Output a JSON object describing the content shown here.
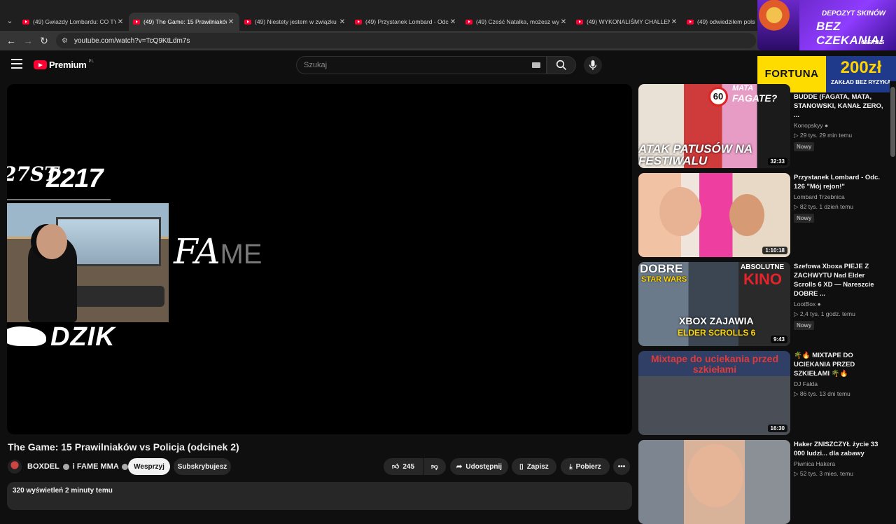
{
  "tabs": [
    {
      "title": "(49) Gwiazdy Lombardu: CO TY",
      "active": false
    },
    {
      "title": "(49) The Game: 15 Prawilniaków",
      "active": true
    },
    {
      "title": "(49) Niestety jestem w związku",
      "active": false
    },
    {
      "title": "(49) Przystanek Lombard - Odc",
      "active": false
    },
    {
      "title": "(49) Cześć Natalka, możesz wyj",
      "active": false
    },
    {
      "title": "(49) WYKONALIŚMY CHALLENG",
      "active": false
    },
    {
      "title": "(49) odwiedziłem polskie",
      "active": false
    }
  ],
  "address": {
    "url": "youtube.com/watch?v=TcQ9KtLdm7s"
  },
  "ads": {
    "skins": {
      "line1": "DEPOZYT SKINÓW",
      "line2": "BEZ CZEKANIA!",
      "brand": "64SKINS"
    },
    "fortuna": {
      "brand": "FORTUNA",
      "amount": "200zł",
      "note": "ZAKŁAD BEZ RYZYKA"
    }
  },
  "header": {
    "brand": "Premium",
    "region": "PL",
    "search_placeholder": "Szukaj"
  },
  "overlay": {
    "tag_sig": "27ST",
    "tag_number": "2217",
    "dzik": "DZIK",
    "fame_italic": "FA",
    "fame_rest": "ME"
  },
  "video": {
    "title": "The Game: 15 Prawilniaków vs Policja (odcinek 2)",
    "channel": "BOXDEL",
    "channel_sep": "i",
    "channel2": "FAME MMA",
    "support": "Wesprzyj",
    "subscribed": "Subskrybujesz",
    "likes": "245",
    "share": "Udostępnij",
    "save": "Zapisz",
    "download": "Pobierz",
    "stats": "320 wyświetleń  2 minuty temu"
  },
  "recommendations": [
    {
      "title": "BUDDE (FAGATA, MATA, STANOWSKI, KANAŁ ZERO, ...",
      "channel": "Konopskyy",
      "verified": true,
      "views": "29 tys.",
      "age": "29 min temu",
      "badge": "Nowy",
      "duration": "32:33",
      "thumb_text": "ATAK PATUSÓW NA FESTIWALU",
      "thumb_top": "MATA",
      "thumb_top2": "FAGATE?",
      "thumb_sign": "60"
    },
    {
      "title": "Przystanek Lombard - Odc. 126 \"Mój rejon!\"",
      "channel": "Lombard Trzebnica",
      "verified": false,
      "views": "82 tys.",
      "age": "1 dzień temu",
      "badge": "Nowy",
      "duration": "1:10:18"
    },
    {
      "title": "Szefowa Xboxa PIEJE Z ZACHWYTU Nad Elder Scrolls 6 XD — Nareszcie DOBRE ...",
      "channel": "LootBox",
      "verified": true,
      "views": "2,4 tys.",
      "age": "1 godz. temu",
      "badge": "Nowy",
      "duration": "9:43",
      "thumb_l1": "DOBRE",
      "thumb_l2": "STAR WARS",
      "thumb_r1": "ABSOLUTNE",
      "thumb_r2": "KINO",
      "thumb_b1": "XBOX ZAJAWIA",
      "thumb_b2": "ELDER SCROLLS 6"
    },
    {
      "title": "🌴🔥 MIXTAPE DO UCIEKANIA PRZED SZKIEŁAMI 🌴🔥",
      "channel": "DJ Fałda",
      "verified": false,
      "views": "86 tys.",
      "age": "13 dni temu",
      "badge": "",
      "duration": "16:30",
      "thumb_text": "Mixtape do uciekania przed szkiełami"
    },
    {
      "title": "Haker ZNISZCZYŁ życie 33 000 ludzi... dla zabawy",
      "channel": "Piwnica Hakera",
      "verified": false,
      "views": "52 tys.",
      "age": "3 mies. temu",
      "badge": "",
      "duration": ""
    }
  ]
}
